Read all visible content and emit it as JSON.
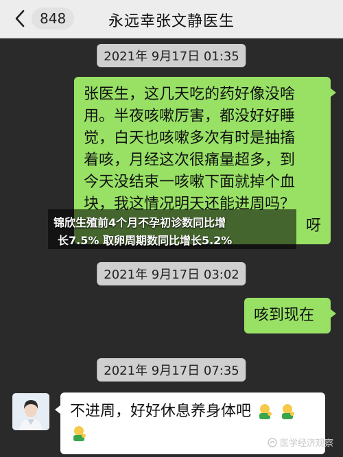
{
  "header": {
    "unread_count": "848",
    "title": "永远幸张文静医生"
  },
  "messages": [
    {
      "type": "timestamp",
      "text": "2021年 9月17日 01:35"
    },
    {
      "type": "outgoing",
      "lines": [
        "张医生，这几天吃的药好像没啥",
        "用。半夜咳嗽厉害，都没好好睡",
        "觉，白天也咳嗽多次有时是抽搐",
        "着咳，月经这次很痛量超多，到",
        "今天没结束一咳嗽下面就掉个血",
        "块，我这情况明天还能进周吗？",
        "呀"
      ]
    },
    {
      "type": "timestamp",
      "text": "2021年 9月17日 03:02"
    },
    {
      "type": "outgoing",
      "text": "咳到现在"
    },
    {
      "type": "timestamp",
      "text": "2021年 9月17日 07:35"
    },
    {
      "type": "incoming",
      "text": "不进周，好好休息养身体吧"
    }
  ],
  "overlay": {
    "line1": "锦欣生殖前4个月不孕初诊数同比增",
    "line2": "长7.5% 取卵周期数同比增长5.2%"
  },
  "watermark": {
    "text": "医学经济观察"
  },
  "icons": {
    "back": "chevron-left-icon",
    "emoji": "thumbs-up-person-emoji",
    "watermark": "sohu-logo-icon"
  }
}
